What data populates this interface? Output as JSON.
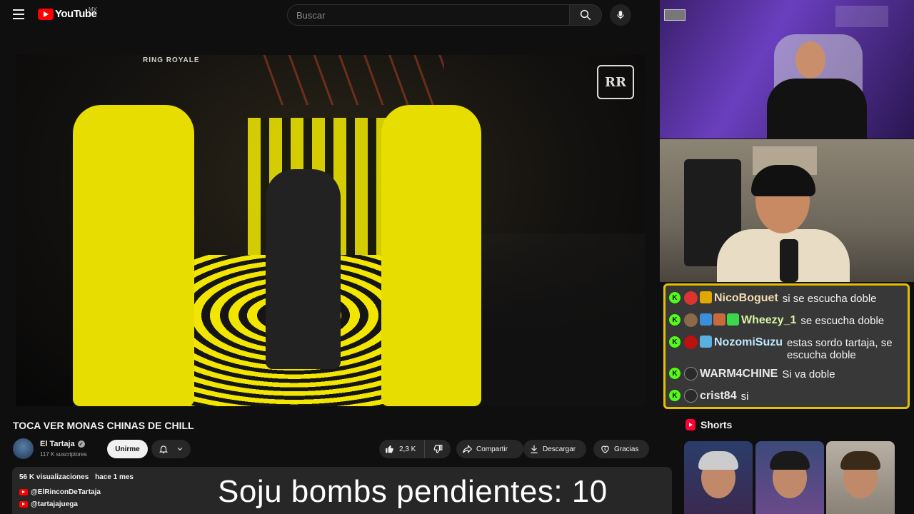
{
  "header": {
    "logo_text": "YouTube",
    "country_code": "MX",
    "search_placeholder": "Buscar"
  },
  "video": {
    "title": "TOCA VER MONAS CHINAS DE CHILL",
    "overlay_watermark": "RING ROYALE",
    "overlay_logo": "RR"
  },
  "channel": {
    "name": "El Tartaja",
    "subscribers": "117 K suscriptores",
    "subscribe_label": "Unirme"
  },
  "actions": {
    "likes": "2,3 K",
    "share_label": "Compartir",
    "download_label": "Descargar",
    "thanks_label": "Gracias"
  },
  "description": {
    "views": "56 K visualizaciones",
    "age": "hace 1 mes",
    "links": [
      "@ElRinconDeTartaja",
      "@tartajajuega"
    ]
  },
  "stream_overlay": {
    "text": "Soju bombs pendientes: 10"
  },
  "chat": {
    "accent_color": "#e6c000",
    "messages": [
      {
        "user": "NicoBoguet",
        "text": "si se escucha doble"
      },
      {
        "user": "Wheezy_1",
        "text": "se escucha doble"
      },
      {
        "user": "NozomiSuzu",
        "text": "estas sordo tartaja, se escucha doble"
      },
      {
        "user": "WARM4CHINE",
        "text": "Si va doble"
      },
      {
        "user": "crist84",
        "text": "si"
      }
    ]
  },
  "shorts": {
    "title": "Shorts"
  }
}
